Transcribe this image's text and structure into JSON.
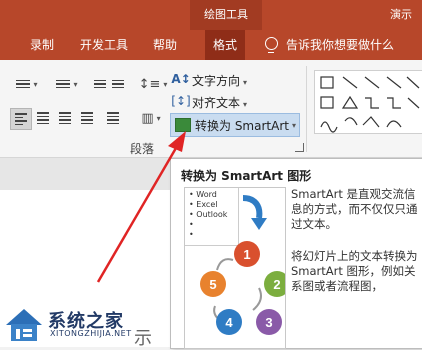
{
  "titlebar": {
    "drawing_tools": "绘图工具",
    "present": "演示"
  },
  "menu": {
    "tabs": [
      "录制",
      "开发工具",
      "帮助",
      "格式"
    ],
    "tell_me": "告诉我你想要做什么"
  },
  "ribbon": {
    "text_direction": "文字方向",
    "align_text": "对齐文本",
    "convert_smartart": "转换为 SmartArt",
    "group_paragraph": "段落"
  },
  "tooltip": {
    "title": "转换为 SmartArt 图形",
    "preview_items": [
      "Word",
      "Excel",
      "Outlook"
    ],
    "cycle_numbers": [
      "1",
      "2",
      "3",
      "4",
      "5"
    ],
    "desc1": "SmartArt 是直观交流信息的方式，而不仅仅只通过文本。",
    "desc2": "将幻灯片上的文本转换为 SmartArt 图形，例如关系图或者流程图，"
  },
  "slide": {
    "partial_text": "示"
  },
  "watermark": {
    "name": "系统之家",
    "url": "XITONGZHIJIA.NET"
  },
  "colors": {
    "accent": "#b7472a",
    "arrow": "#e02424",
    "cycle": [
      "#d9502e",
      "#7cae3f",
      "#8a5aa8",
      "#2f7cc4",
      "#e8822e"
    ]
  }
}
